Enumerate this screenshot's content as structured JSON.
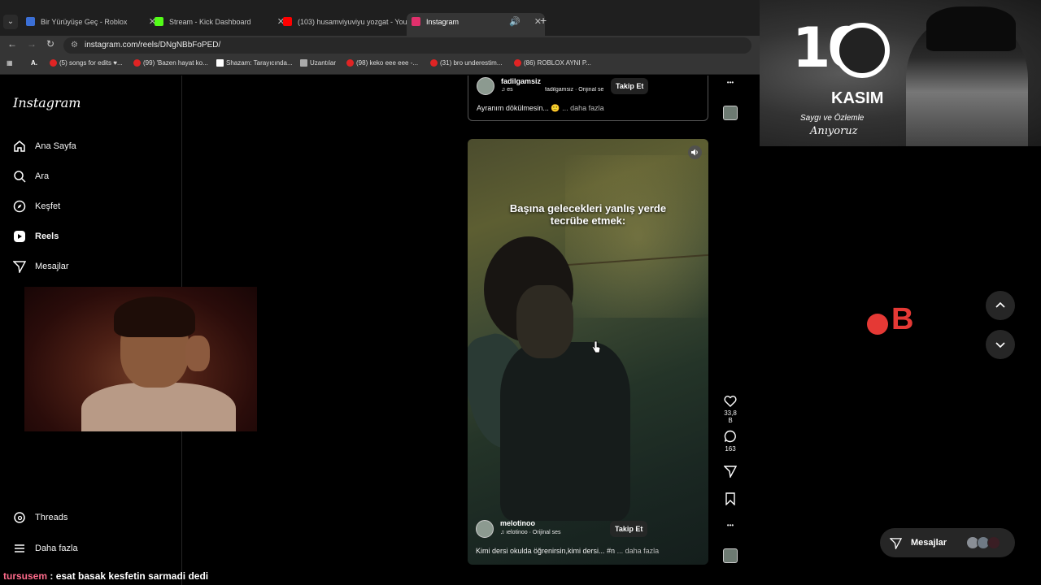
{
  "browser": {
    "tabs": [
      {
        "label": "Bir Yürüyüşe Geç - Roblox",
        "icon": "roblox-icon",
        "color": "#3b6fd6"
      },
      {
        "label": "Stream - Kick Dashboard",
        "icon": "kick-icon",
        "color": "#53fc18"
      },
      {
        "label": "(103) husamviyuviyu yozgat - YouTube",
        "icon": "youtube-icon",
        "color": "#ff0000"
      },
      {
        "label": "Instagram",
        "icon": "instagram-icon",
        "color": "#e1306c"
      }
    ],
    "url": "instagram.com/reels/DNgNBbFoPED/",
    "bookmarks": [
      {
        "label": "(5) songs for edits ♥..."
      },
      {
        "label": "(99) 'Bazen hayat ko..."
      },
      {
        "label": "Shazam: Tarayıcında..."
      },
      {
        "label": "Uzantılar"
      },
      {
        "label": "(98) keko eee eee -..."
      },
      {
        "label": "(31) bro underestim..."
      },
      {
        "label": "(86) ROBLOX AYNI P..."
      }
    ]
  },
  "instagram": {
    "logo": "Instagram",
    "nav": [
      {
        "label": "Ana Sayfa",
        "icon": "home-icon"
      },
      {
        "label": "Ara",
        "icon": "search-icon"
      },
      {
        "label": "Keşfet",
        "icon": "compass-icon"
      },
      {
        "label": "Reels",
        "icon": "reels-icon"
      },
      {
        "label": "Mesajlar",
        "icon": "send-icon"
      }
    ],
    "bottom_nav": [
      {
        "label": "Threads",
        "icon": "threads-icon"
      },
      {
        "label": "Daha fazla",
        "icon": "menu-icon"
      }
    ],
    "prev_post": {
      "username": "fadilgamsiz",
      "audio": "fadilgamsiz · Orijinal se",
      "audio_prefix": "♫ es",
      "follow": "Takip Et",
      "caption": "Ayranım dökülmesin... 🙂",
      "more": "... daha fazla"
    },
    "reel": {
      "overlay_text_line1": "Başına gelecekleri yanlış yerde",
      "overlay_text_line2": "tecrübe etmek:",
      "username": "melotinoo",
      "audio": "♫ ıelotinoo · Orijinal ses",
      "follow": "Takip Et",
      "caption": "Kimi dersi okulda öğrenirsin,kimi dersi... #n",
      "more": "... daha fazla",
      "likes": "33,8 B",
      "comments": "163"
    }
  },
  "stream_overlay": {
    "chat_user": "tursusem",
    "chat_message": " : esat basak kesfetin sarmadi dedi",
    "banner": {
      "number": "10",
      "month": "KASIM",
      "subtitle": "Saygı ve Özlemle",
      "signature": "Anıyoruz"
    },
    "messages_label": "Mesajlar"
  }
}
